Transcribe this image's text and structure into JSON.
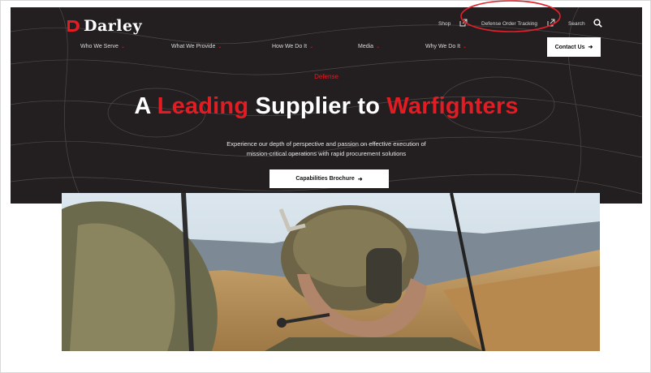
{
  "brand": {
    "name": "Darley"
  },
  "utility_nav": {
    "shop": "Shop",
    "tracking": "Defense Order Tracking",
    "search": "Search"
  },
  "main_nav": {
    "items": [
      {
        "label": "Who We Serve"
      },
      {
        "label": "What We Provide"
      },
      {
        "label": "How We Do It"
      },
      {
        "label": "Media"
      },
      {
        "label": "Why We Do It"
      }
    ],
    "contact": "Contact Us"
  },
  "hero": {
    "eyebrow": "Defense",
    "headline_part1": "A",
    "headline_red1": "Leading",
    "headline_part2": "Supplier to",
    "headline_red2": "Warfighters",
    "subtext_line1": "Experience our depth of perspective and passion on effective execution of",
    "subtext_line2": "mission-critical operations with rapid procurement solutions",
    "cta": "Capabilities Brochure"
  },
  "colors": {
    "hero_bg": "#231f20",
    "accent_red": "#e31b23",
    "annotation_red": "#e0202a"
  },
  "icons": {
    "external_link": "external-link-icon",
    "search": "search-icon",
    "arrow": "arrow-right-icon",
    "chevron": "chevron-down-icon"
  }
}
